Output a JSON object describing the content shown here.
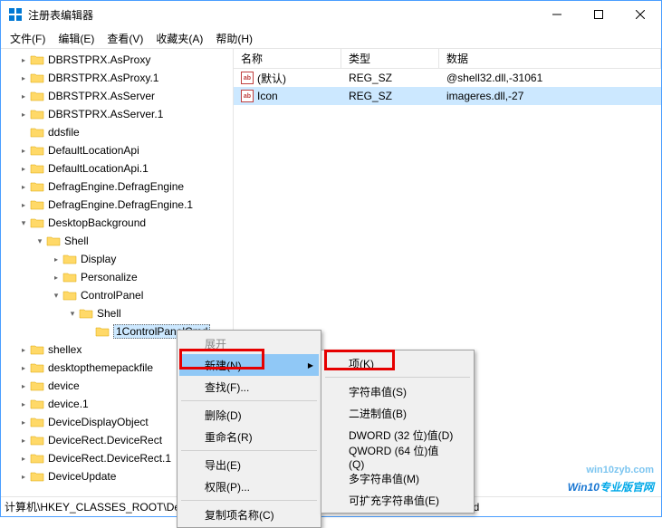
{
  "window": {
    "title": "注册表编辑器"
  },
  "menubar": {
    "file": "文件(F)",
    "edit": "编辑(E)",
    "view": "查看(V)",
    "favorites": "收藏夹(A)",
    "help": "帮助(H)"
  },
  "tree": {
    "items": [
      {
        "indent": 1,
        "toggle": ">",
        "label": "DBRSTPRX.AsProxy"
      },
      {
        "indent": 1,
        "toggle": ">",
        "label": "DBRSTPRX.AsProxy.1"
      },
      {
        "indent": 1,
        "toggle": ">",
        "label": "DBRSTPRX.AsServer"
      },
      {
        "indent": 1,
        "toggle": ">",
        "label": "DBRSTPRX.AsServer.1"
      },
      {
        "indent": 1,
        "toggle": "",
        "label": "ddsfile"
      },
      {
        "indent": 1,
        "toggle": ">",
        "label": "DefaultLocationApi"
      },
      {
        "indent": 1,
        "toggle": ">",
        "label": "DefaultLocationApi.1"
      },
      {
        "indent": 1,
        "toggle": ">",
        "label": "DefragEngine.DefragEngine"
      },
      {
        "indent": 1,
        "toggle": ">",
        "label": "DefragEngine.DefragEngine.1"
      },
      {
        "indent": 1,
        "toggle": "v",
        "label": "DesktopBackground"
      },
      {
        "indent": 2,
        "toggle": "v",
        "label": "Shell"
      },
      {
        "indent": 3,
        "toggle": ">",
        "label": "Display"
      },
      {
        "indent": 3,
        "toggle": ">",
        "label": "Personalize"
      },
      {
        "indent": 3,
        "toggle": "v",
        "label": "ControlPanel"
      },
      {
        "indent": 4,
        "toggle": "v",
        "label": "Shell"
      },
      {
        "indent": 5,
        "toggle": "",
        "label": "1ControlPanelCmd",
        "selected": true
      },
      {
        "indent": 1,
        "toggle": ">",
        "label": "shellex"
      },
      {
        "indent": 1,
        "toggle": ">",
        "label": "desktopthemepackfile"
      },
      {
        "indent": 1,
        "toggle": ">",
        "label": "device"
      },
      {
        "indent": 1,
        "toggle": ">",
        "label": "device.1"
      },
      {
        "indent": 1,
        "toggle": ">",
        "label": "DeviceDisplayObject"
      },
      {
        "indent": 1,
        "toggle": ">",
        "label": "DeviceRect.DeviceRect"
      },
      {
        "indent": 1,
        "toggle": ">",
        "label": "DeviceRect.DeviceRect.1"
      },
      {
        "indent": 1,
        "toggle": ">",
        "label": "DeviceUpdate"
      }
    ]
  },
  "listview": {
    "headers": {
      "name": "名称",
      "type": "类型",
      "data": "数据"
    },
    "rows": [
      {
        "name": "(默认)",
        "type": "REG_SZ",
        "data": "@shell32.dll,-31061"
      },
      {
        "name": "Icon",
        "type": "REG_SZ",
        "data": "imageres.dll,-27",
        "selected": true
      }
    ]
  },
  "statusbar": {
    "path": "计算机\\HKEY_CLASSES_ROOT\\DesktopBackground\\Shell\\ControlPanel\\Shell\\1ControlPanelCmd"
  },
  "contextMenu1": {
    "expand": "展开",
    "new": "新建(N)",
    "find": "查找(F)...",
    "delete": "删除(D)",
    "rename": "重命名(R)",
    "export": "导出(E)",
    "permissions": "权限(P)...",
    "copyKeyName": "复制项名称(C)"
  },
  "contextMenu2": {
    "key": "项(K)",
    "string": "字符串值(S)",
    "binary": "二进制值(B)",
    "dword": "DWORD (32 位)值(D)",
    "qword": "QWORD (64 位)值(Q)",
    "multiString": "多字符串值(M)",
    "expandString": "可扩充字符串值(E)"
  },
  "watermark": {
    "domain": "win10zyb.com",
    "text1": "Win10",
    "text2": "专业版官网"
  }
}
